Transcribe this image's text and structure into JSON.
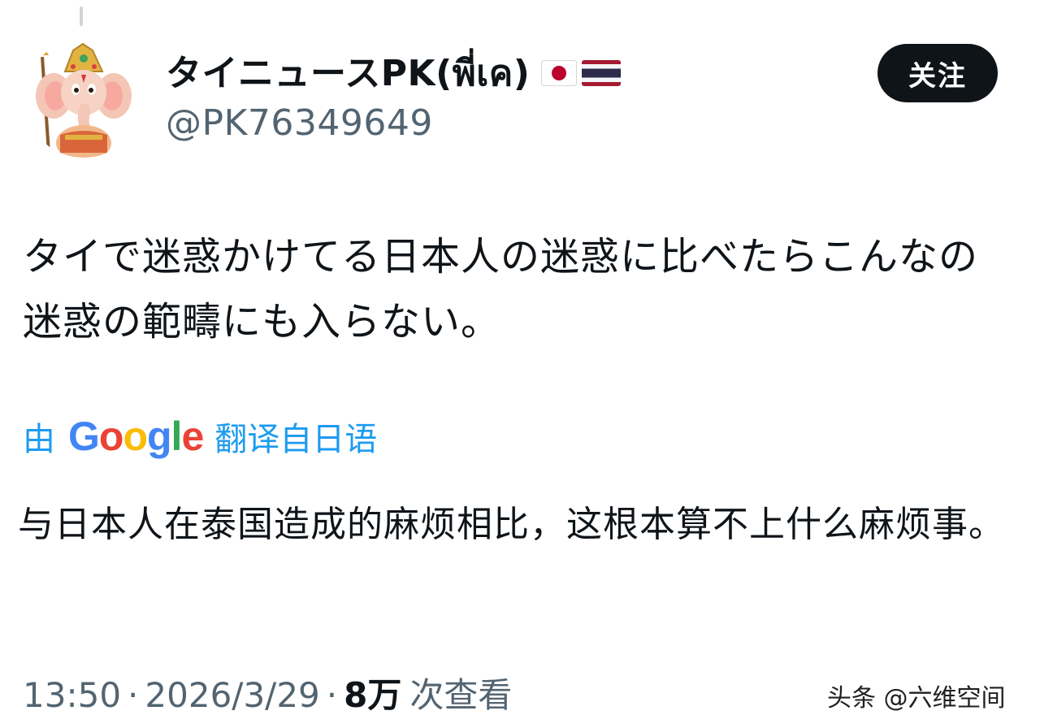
{
  "profile": {
    "display_name": "タイニュースPK(พี่เค)",
    "handle": "@PK76349649",
    "flags": [
      "japan-flag-icon",
      "thailand-flag-icon"
    ]
  },
  "follow_button": {
    "label": "关注"
  },
  "tweet": {
    "text": "タイで迷惑かけてる日本人の迷惑に比べたらこんなの迷惑の範疇にも入らない。"
  },
  "translation": {
    "prefix": "由",
    "provider_letters": [
      "G",
      "o",
      "o",
      "g",
      "l",
      "e"
    ],
    "suffix": "翻译自日语",
    "text": "与日本人在泰国造成的麻烦相比，这根本算不上什么麻烦事。"
  },
  "meta": {
    "time": "13:50",
    "date": "2026/3/29",
    "separator": "·",
    "views_count": "8万",
    "views_label": "次查看"
  },
  "watermark": {
    "text": "头条 @六维空间"
  },
  "colors": {
    "accent": "#1d9bf0",
    "follow_bg": "#0f1419",
    "secondary_text": "#536471"
  }
}
